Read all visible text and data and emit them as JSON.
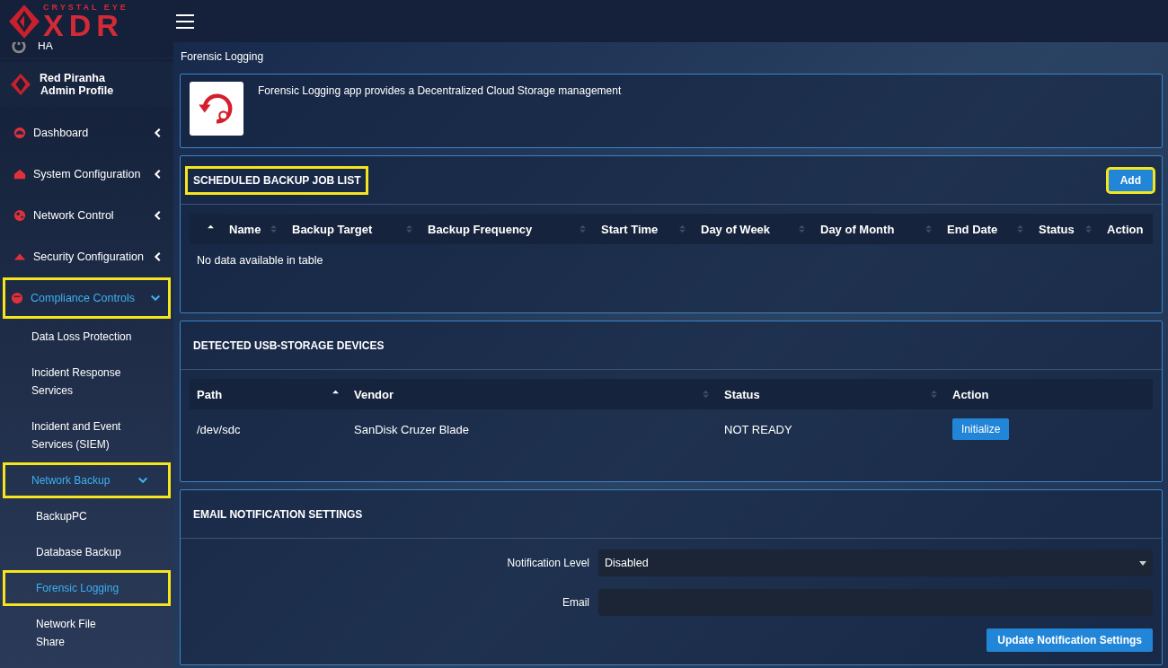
{
  "logo": {
    "tagline": "CRYSTAL EYE",
    "wordmark": "XDR"
  },
  "sidebar": {
    "status_item": {
      "label": "HA"
    },
    "profile": {
      "name": "Red Piranha",
      "role": "Admin Profile"
    },
    "items": [
      {
        "label": "Dashboard",
        "expanded": false,
        "selected": false,
        "highlighted": false
      },
      {
        "label": "System Configuration",
        "expanded": false,
        "selected": false,
        "highlighted": false
      },
      {
        "label": "Network Control",
        "expanded": false,
        "selected": false,
        "highlighted": false
      },
      {
        "label": "Security Configuration",
        "expanded": false,
        "selected": false,
        "highlighted": false
      },
      {
        "label": "Compliance Controls",
        "expanded": true,
        "selected": true,
        "highlighted": true,
        "children": [
          {
            "label": "Data Loss Protection",
            "selected": false,
            "highlighted": false
          },
          {
            "label": "Incident Response Services",
            "selected": false,
            "highlighted": false
          },
          {
            "label": "Incident and Event Services (SIEM)",
            "selected": false,
            "highlighted": false
          },
          {
            "label": "Network Backup",
            "expanded": true,
            "selected": true,
            "highlighted": true,
            "children": [
              {
                "label": "BackupPC",
                "selected": false,
                "highlighted": false
              },
              {
                "label": "Database Backup",
                "selected": false,
                "highlighted": false
              },
              {
                "label": "Forensic Logging",
                "selected": true,
                "highlighted": true
              },
              {
                "label": "Network File Share",
                "selected": false,
                "highlighted": false
              }
            ]
          }
        ]
      }
    ]
  },
  "page_title": "Forensic Logging",
  "intro": {
    "text": "Forensic Logging app provides a Decentralized Cloud Storage management"
  },
  "scheduled_jobs": {
    "title": "SCHEDULED BACKUP JOB LIST",
    "title_highlighted": true,
    "add_button": {
      "label": "Add",
      "highlighted": true
    },
    "columns": [
      {
        "sortable": true,
        "sorted": true
      },
      {
        "label": "Name",
        "sortable": true,
        "sorted": false
      },
      {
        "label": "Backup Target",
        "sortable": true,
        "sorted": false
      },
      {
        "label": "Backup Frequency",
        "sortable": true,
        "sorted": false
      },
      {
        "label": "Start Time",
        "sortable": true,
        "sorted": false
      },
      {
        "label": "Day of Week",
        "sortable": true,
        "sorted": false
      },
      {
        "label": "Day of Month",
        "sortable": true,
        "sorted": false
      },
      {
        "label": "End Date",
        "sortable": true,
        "sorted": false
      },
      {
        "label": "Status",
        "sortable": true,
        "sorted": false
      },
      {
        "label": "Action",
        "sortable": false
      }
    ],
    "empty_message": "No data available in table"
  },
  "usb_devices": {
    "title": "DETECTED USB-STORAGE DEVICES",
    "columns": [
      {
        "label": "Path",
        "sortable": true,
        "sorted": true
      },
      {
        "label": "Vendor",
        "sortable": true,
        "sorted": false
      },
      {
        "label": "Status",
        "sortable": true,
        "sorted": false
      },
      {
        "label": "Action",
        "sortable": false
      }
    ],
    "rows": [
      {
        "path": "/dev/sdc",
        "vendor": "SanDisk Cruzer Blade",
        "status": "NOT READY",
        "action": "Initialize"
      }
    ]
  },
  "email_settings": {
    "title": "EMAIL NOTIFICATION SETTINGS",
    "notification_level": {
      "label": "Notification Level",
      "value": "Disabled"
    },
    "email": {
      "label": "Email"
    },
    "submit": "Update Notification Settings"
  }
}
